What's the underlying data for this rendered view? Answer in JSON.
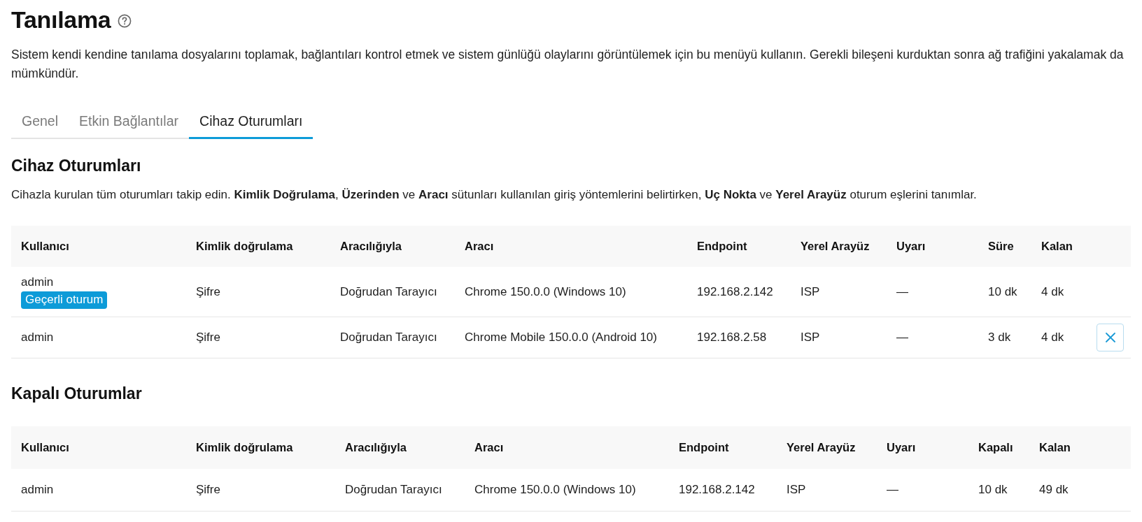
{
  "page": {
    "title": "Tanılama",
    "description": "Sistem kendi kendine tanılama dosyalarını toplamak, bağlantıları kontrol etmek ve sistem günlüğü olaylarını görüntülemek için bu menüyü kullanın. Gerekli bileşeni kurduktan sonra ağ trafiğini yakalamak da mümkündür."
  },
  "tabs": [
    {
      "label": "Genel",
      "selected": false
    },
    {
      "label": "Etkin Bağlantılar",
      "selected": false
    },
    {
      "label": "Cihaz Oturumları",
      "selected": true
    }
  ],
  "sections": [
    {
      "title": "Cihaz Oturumları",
      "description": "Cihazla kurulan tüm oturumları takip edin. **Kimlik Doğrulama**, **Üzerinden** ve **Aracı** sütunları kullanılan giriş yöntemlerini belirtirken, **Uç Nokta** ve **Yerel Arayüz** oturum eşlerini tanımlar.",
      "table": {
        "columns": [
          "Kullanıcı",
          "Kimlik doğrulama",
          "Aracılığıyla",
          "Aracı",
          "Endpoint",
          "Yerel Arayüz",
          "Uyarı",
          "Süre",
          "Kalan"
        ],
        "rows": [
          {
            "cells": [
              "admin",
              "Şifre",
              "Doğrudan Tarayıcı",
              "Chrome 150.0.0 (Windows 10)",
              "192.168.2.142",
              "ISP",
              "—",
              "10 dk",
              "4 dk"
            ],
            "badge": "Geçerli oturum",
            "terminable": false
          },
          {
            "cells": [
              "admin",
              "Şifre",
              "Doğrudan Tarayıcı",
              "Chrome Mobile 150.0.0 (Android 10)",
              "192.168.2.58",
              "ISP",
              "—",
              "3 dk",
              "4 dk"
            ],
            "terminable": true
          }
        ]
      }
    },
    {
      "title": "Kapalı Oturumlar",
      "table": {
        "columns": [
          "Kullanıcı",
          "Kimlik doğrulama",
          "Aracılığıyla",
          "Aracı",
          "Endpoint",
          "Yerel Arayüz",
          "Uyarı",
          "Kapalı",
          "Kalan"
        ],
        "rows": [
          {
            "cells": [
              "admin",
              "Şifre",
              "Doğrudan Tarayıcı",
              "Chrome 150.0.0 (Windows 10)",
              "192.168.2.142",
              "ISP",
              "—",
              "10 dk",
              "49 dk"
            ]
          }
        ]
      }
    }
  ]
}
